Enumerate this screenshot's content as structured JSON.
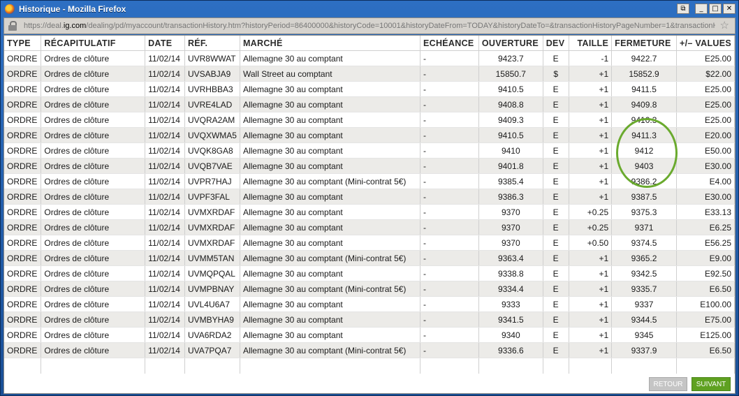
{
  "window": {
    "title": "Historique - Mozilla Firefox",
    "url_prefix": "https://deal.",
    "url_host": "ig.com",
    "url_rest": "/dealing/pd/myaccount/transactionHistory.htm?historyPeriod=86400000&historyCode=10001&historyDateFrom=TODAY&historyDateTo=&transactionHistoryPageNumber=1&transactionH"
  },
  "table": {
    "headers": [
      "TYPE",
      "RÉCAPITULATIF",
      "DATE",
      "RÉF.",
      "MARCHÉ",
      "ECHÉANCE",
      "OUVERTURE",
      "DEV",
      "TAILLE",
      "FERMETURE",
      "+/– VALUES"
    ],
    "rows": [
      [
        "ORDRE",
        "Ordres de clôture",
        "11/02/14",
        "UVR8WWAT",
        "Allemagne 30 au comptant",
        "-",
        "9423.7",
        "E",
        "-1",
        "9422.7",
        "E25.00"
      ],
      [
        "ORDRE",
        "Ordres de clôture",
        "11/02/14",
        "UVSABJA9",
        "Wall Street au comptant",
        "-",
        "15850.7",
        "$",
        "+1",
        "15852.9",
        "$22.00"
      ],
      [
        "ORDRE",
        "Ordres de clôture",
        "11/02/14",
        "UVRHBBA3",
        "Allemagne 30 au comptant",
        "-",
        "9410.5",
        "E",
        "+1",
        "9411.5",
        "E25.00"
      ],
      [
        "ORDRE",
        "Ordres de clôture",
        "11/02/14",
        "UVRE4LAD",
        "Allemagne 30 au comptant",
        "-",
        "9408.8",
        "E",
        "+1",
        "9409.8",
        "E25.00"
      ],
      [
        "ORDRE",
        "Ordres de clôture",
        "11/02/14",
        "UVQRA2AM",
        "Allemagne 30 au comptant",
        "-",
        "9409.3",
        "E",
        "+1",
        "9410.3",
        "E25.00"
      ],
      [
        "ORDRE",
        "Ordres de clôture",
        "11/02/14",
        "UVQXWMA5",
        "Allemagne 30 au comptant",
        "-",
        "9410.5",
        "E",
        "+1",
        "9411.3",
        "E20.00"
      ],
      [
        "ORDRE",
        "Ordres de clôture",
        "11/02/14",
        "UVQK8GA8",
        "Allemagne 30 au comptant",
        "-",
        "9410",
        "E",
        "+1",
        "9412",
        "E50.00"
      ],
      [
        "ORDRE",
        "Ordres de clôture",
        "11/02/14",
        "UVQB7VAE",
        "Allemagne 30 au comptant",
        "-",
        "9401.8",
        "E",
        "+1",
        "9403",
        "E30.00"
      ],
      [
        "ORDRE",
        "Ordres de clôture",
        "11/02/14",
        "UVPR7HAJ",
        "Allemagne 30 au comptant (Mini-contrat 5€)",
        "-",
        "9385.4",
        "E",
        "+1",
        "9386.2",
        "E4.00"
      ],
      [
        "ORDRE",
        "Ordres de clôture",
        "11/02/14",
        "UVPF3FAL",
        "Allemagne 30 au comptant",
        "-",
        "9386.3",
        "E",
        "+1",
        "9387.5",
        "E30.00"
      ],
      [
        "ORDRE",
        "Ordres de clôture",
        "11/02/14",
        "UVMXRDAF",
        "Allemagne 30 au comptant",
        "-",
        "9370",
        "E",
        "+0.25",
        "9375.3",
        "E33.13"
      ],
      [
        "ORDRE",
        "Ordres de clôture",
        "11/02/14",
        "UVMXRDAF",
        "Allemagne 30 au comptant",
        "-",
        "9370",
        "E",
        "+0.25",
        "9371",
        "E6.25"
      ],
      [
        "ORDRE",
        "Ordres de clôture",
        "11/02/14",
        "UVMXRDAF",
        "Allemagne 30 au comptant",
        "-",
        "9370",
        "E",
        "+0.50",
        "9374.5",
        "E56.25"
      ],
      [
        "ORDRE",
        "Ordres de clôture",
        "11/02/14",
        "UVMM5TAN",
        "Allemagne 30 au comptant (Mini-contrat 5€)",
        "-",
        "9363.4",
        "E",
        "+1",
        "9365.2",
        "E9.00"
      ],
      [
        "ORDRE",
        "Ordres de clôture",
        "11/02/14",
        "UVMQPQAL",
        "Allemagne 30 au comptant",
        "-",
        "9338.8",
        "E",
        "+1",
        "9342.5",
        "E92.50"
      ],
      [
        "ORDRE",
        "Ordres de clôture",
        "11/02/14",
        "UVMPBNAY",
        "Allemagne 30 au comptant (Mini-contrat 5€)",
        "-",
        "9334.4",
        "E",
        "+1",
        "9335.7",
        "E6.50"
      ],
      [
        "ORDRE",
        "Ordres de clôture",
        "11/02/14",
        "UVL4U6A7",
        "Allemagne 30 au comptant",
        "-",
        "9333",
        "E",
        "+1",
        "9337",
        "E100.00"
      ],
      [
        "ORDRE",
        "Ordres de clôture",
        "11/02/14",
        "UVMBYHA9",
        "Allemagne 30 au comptant",
        "-",
        "9341.5",
        "E",
        "+1",
        "9344.5",
        "E75.00"
      ],
      [
        "ORDRE",
        "Ordres de clôture",
        "11/02/14",
        "UVA6RDA2",
        "Allemagne 30 au comptant",
        "-",
        "9340",
        "E",
        "+1",
        "9345",
        "E125.00"
      ],
      [
        "ORDRE",
        "Ordres de clôture",
        "11/02/14",
        "UVA7PQA7",
        "Allemagne 30 au comptant (Mini-contrat 5€)",
        "-",
        "9336.6",
        "E",
        "+1",
        "9337.9",
        "E6.50"
      ]
    ]
  },
  "buttons": {
    "retour": "RETOUR",
    "suivant": "SUIVANT"
  },
  "colors": {
    "highlight_circle": "#6aaa2e",
    "suivant_bg": "#5fa121"
  }
}
